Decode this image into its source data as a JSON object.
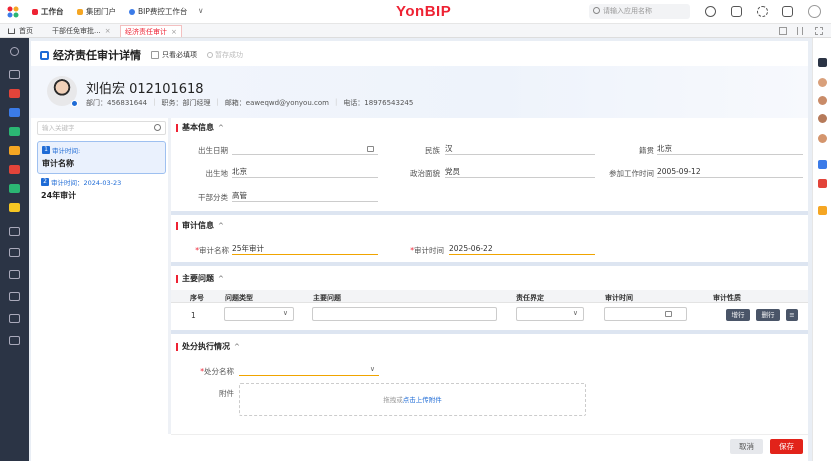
{
  "topbar": {
    "tabs": [
      {
        "label": "工作台",
        "color": "#e23"
      },
      {
        "label": "集团门户",
        "color": "#f5a623"
      },
      {
        "label": "BIP费控工作台",
        "color": "#3b7be8"
      }
    ],
    "more": "∨",
    "brand": "YonBIP",
    "search_placeholder": "请输入应用名称"
  },
  "window_tabs": [
    {
      "label": "首页"
    },
    {
      "label": "干部任免审批...",
      "close": "×"
    },
    {
      "label": "经济责任审计",
      "close": "×",
      "active": true
    }
  ],
  "page": {
    "title": "经济责任审计详情",
    "only_required_label": "只看必填项",
    "save_status": "暂存成功"
  },
  "profile": {
    "name": "刘伯宏 012101618",
    "department": "部门：456831644",
    "position": "职务：部门经理",
    "email": "邮箱：eaweqwd@yonyou.com",
    "phone": "电话：18976543245"
  },
  "left_list": {
    "search_placeholder": "输入关键字",
    "items": [
      {
        "num": "1",
        "time": "审计时间: ",
        "name": "审计名称",
        "selected": true
      },
      {
        "num": "2",
        "time": "审计时间：2024-03-23",
        "name": "24年审计",
        "selected": false
      }
    ]
  },
  "basic": {
    "title": "基本信息",
    "caret": "^",
    "birth_date_label": "出生日期",
    "birth_date_value": "",
    "ethnicity_label": "民族",
    "ethnicity_value": "汉",
    "native_label": "籍贯",
    "native_value": "北京",
    "birthplace_label": "出生地",
    "birthplace_value": "北京",
    "political_label": "政治面貌",
    "political_value": "党员",
    "workstart_label": "参加工作时间",
    "workstart_value": "2005-09-12",
    "cadre_label": "干部分类",
    "cadre_value": "高管"
  },
  "audit": {
    "title": "审计信息",
    "caret": "^",
    "name_label": "审计名称",
    "name_value": "25年审计",
    "time_label": "审计时间",
    "time_value": "2025-06-22",
    "required_mark": "*"
  },
  "issues": {
    "title": "主要问题",
    "caret": "^",
    "columns": [
      "序号",
      "问题类型",
      "主要问题",
      "责任界定",
      "审计时间",
      "审计性质"
    ],
    "row_index": "1",
    "add_row": "增行",
    "delete_row": "删行"
  },
  "penalty": {
    "title": "处分执行情况",
    "caret": "^",
    "name_label": "处分名称",
    "required_mark": "*",
    "attach_label": "附件",
    "upload_prefix": "拖拽或",
    "upload_link": "点击上传附件"
  },
  "footer": {
    "cancel": "取消",
    "save": "保存"
  },
  "colors": {
    "accent": "#e23",
    "primary": "#1e6bd6",
    "rail": "#2b3445"
  }
}
